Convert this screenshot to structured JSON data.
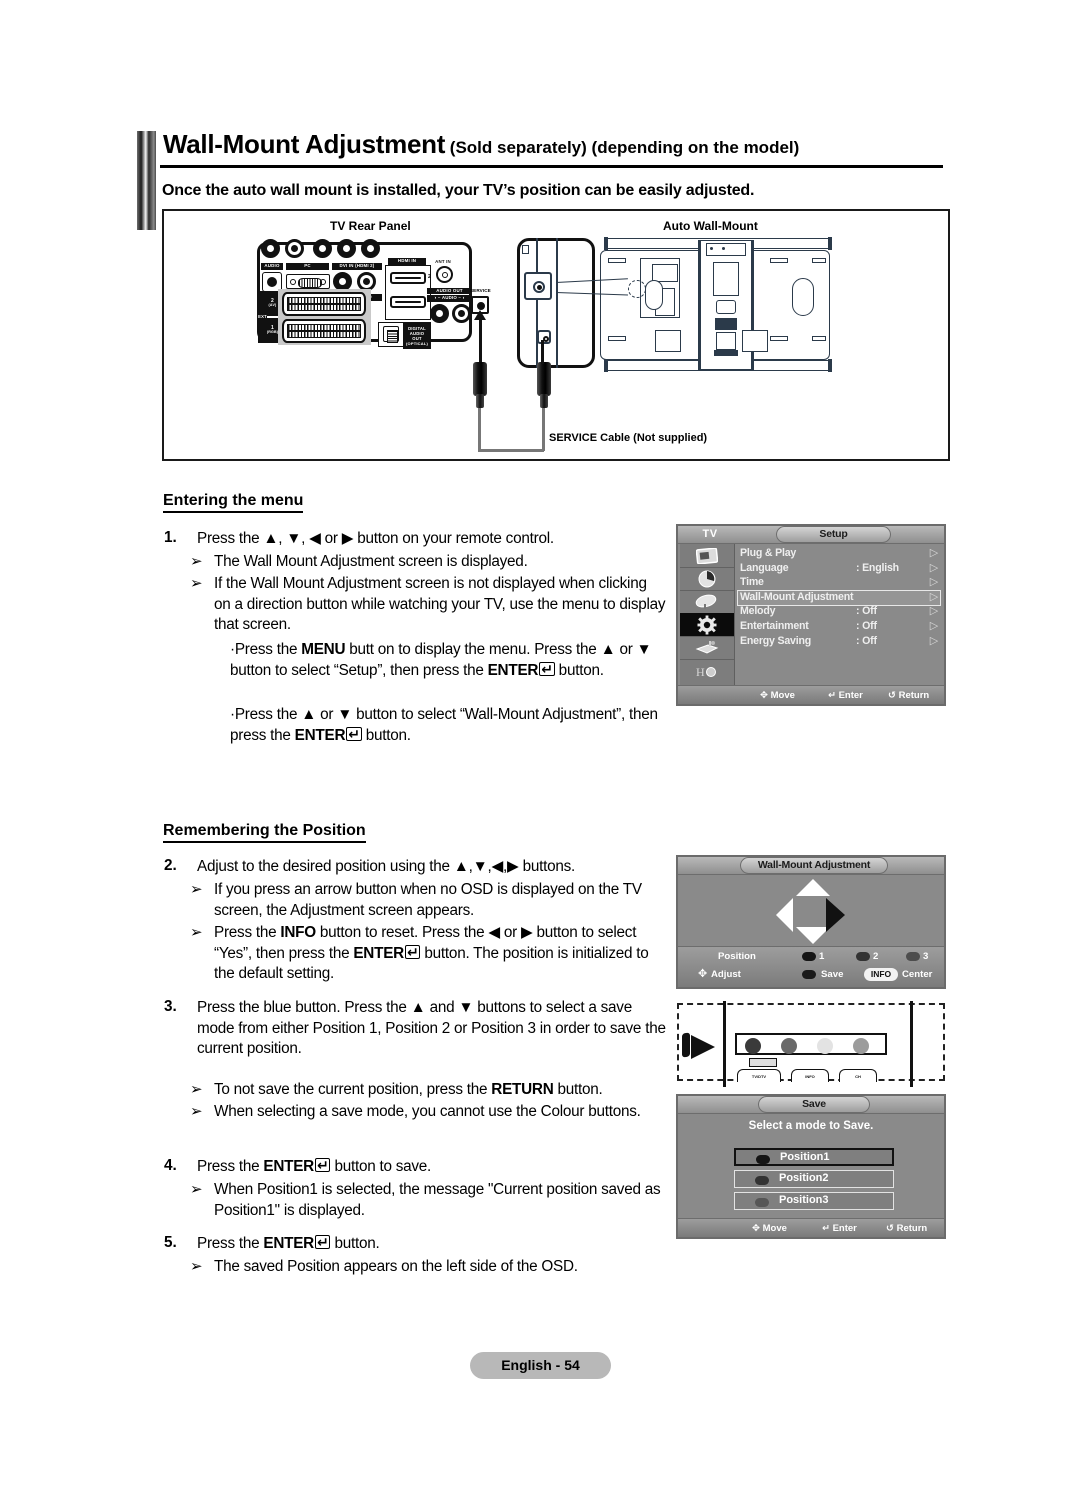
{
  "header": {
    "title_main": "Wall-Mount Adjustment",
    "title_note1": "(Sold separately)",
    "title_note2": "(depending on the model)",
    "subtitle": "Once the auto wall mount is installed, your TV’s position can be easily adjusted."
  },
  "figure": {
    "caption_left": "TV Rear Panel",
    "caption_right": "Auto Wall-Mount",
    "caption_cable": "SERVICE Cable (Not supplied)",
    "panel_labels": {
      "audio": "AUDIO",
      "pc": "PC",
      "dvi": "DVI IN (HDMI 2)",
      "dvi_audio": "AUDIO",
      "hdmi": "HDMI IN",
      "hdmi_2": "2",
      "hdmi_1": "1",
      "ant": "ANT IN",
      "audio_out": "AUDIO OUT",
      "audio_out_lr": "AUDIO",
      "service": "SERVICE",
      "ext": "EXT",
      "scart2": "2",
      "scart2_sub": "(AV)",
      "scart1": "1",
      "scart1_sub": "(RGB)",
      "digital_audio": "DIGITAL AUDIO OUT (OPTICAL)"
    }
  },
  "section1": {
    "heading": "Entering the menu",
    "step_num": "1.",
    "step_text": "Press the ▲, ▼, ◀ or ▶ button on your remote control.",
    "bullets": [
      "The Wall Mount Adjustment screen is displayed.",
      "If the Wall Mount Adjustment screen is not displayed when clicking on a direction button while watching your TV, use the menu to display that screen."
    ],
    "sub_bullets": [
      "Press the MENU butt on to display the menu. Press the ▲ or ▼ button to select “Setup”, then press the ENTER↵ button.",
      "Press the ▲ or ▼ button to select “Wall-Mount Adjustment”, then press the ENTER↵ button."
    ]
  },
  "section2": {
    "heading": "Remembering the Position",
    "step2_num": "2.",
    "step2_text": "Adjust to the desired position using the ▲,▼,◀,▶ buttons.",
    "step2_bullets": [
      "If you press an arrow button when no OSD is displayed on the TV screen, the Adjustment screen appears.",
      "Press the INFO button to reset. Press the ◀ or ▶ button to select “Yes”, then press the ENTER↵ button. The position is initialized to the default setting."
    ],
    "step3_num": "3.",
    "step3_text": "Press the blue button. Press the ▲ and ▼ buttons to select a save mode from either Position 1, Position 2 or Position 3 in order to save the current position.",
    "step3_bullets": [
      "To not save the current position, press the RETURN button.",
      "When selecting a save mode, you cannot use the Colour buttons."
    ],
    "step4_num": "4.",
    "step4_text": "Press the ENTER↵ button to save.",
    "step4_bullets": [
      "When Position1 is selected, the message \"Current position saved as Position1\" is displayed."
    ],
    "step5_num": "5.",
    "step5_text": "Press the ENTER↵ button.",
    "step5_bullets": [
      "The saved Position appears on the left side of the OSD."
    ]
  },
  "osd_setup": {
    "source_label": "TV",
    "title": "Setup",
    "rows": [
      {
        "label": "Plug & Play",
        "value": "",
        "arrow": "▷",
        "highlighted": false
      },
      {
        "label": "Language",
        "value": ": English",
        "arrow": "▷",
        "highlighted": false
      },
      {
        "label": "Time",
        "value": "",
        "arrow": "▷",
        "highlighted": false
      },
      {
        "label": "Wall-Mount Adjustment",
        "value": "",
        "arrow": "▷",
        "highlighted": true
      },
      {
        "label": "Melody",
        "value": ": Off",
        "arrow": "▷",
        "highlighted": false
      },
      {
        "label": "Entertainment",
        "value": ": Off",
        "arrow": "▷",
        "highlighted": false
      },
      {
        "label": "Energy Saving",
        "value": ": Off",
        "arrow": "▷",
        "highlighted": false
      }
    ],
    "sidebar_icons": [
      "picture-icon",
      "sound-icon",
      "channel-icon",
      "setup-icon",
      "input-icon",
      "support-icon"
    ],
    "selected_sidebar_index": 3,
    "footer": {
      "move": "✥ Move",
      "enter": "↵ Enter",
      "return": "↺ Return"
    }
  },
  "osd_wallmount": {
    "title": "Wall-Mount Adjustment",
    "position_label": "Position",
    "positions": [
      "1",
      "2",
      "3"
    ],
    "adjust_label": "Adjust",
    "save_label": "Save",
    "info_label": "INFO",
    "center_label": "Center"
  },
  "osd_save": {
    "title": "Save",
    "message": "Select a mode to Save.",
    "options": [
      "Position1",
      "Position2",
      "Position3"
    ],
    "selected_index": 0,
    "footer": {
      "move": "✥ Move",
      "enter": "↵ Enter",
      "return": "↺ Return"
    }
  },
  "remote": {
    "keys": [
      "TV/DTV",
      "INFO",
      "CH"
    ]
  },
  "footer": {
    "page_label": "English - 54"
  },
  "colors": {
    "osd_bg": "#8a8a8a",
    "osd_title_bg": "#b9b9b9",
    "osd_highlight": "#959595",
    "footer_badge": "#b8b8b8",
    "ink": "#000000"
  }
}
